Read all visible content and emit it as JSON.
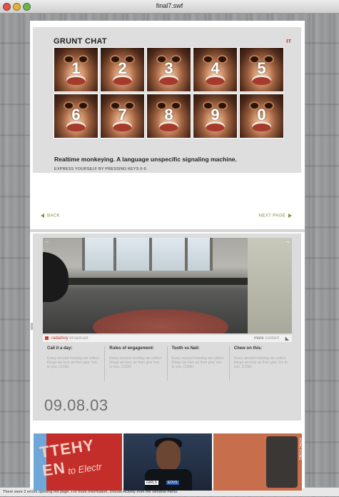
{
  "window": {
    "title": "final7.swf"
  },
  "grunt": {
    "title": "GRUNT CHAT",
    "logo": "rr",
    "faces": [
      "1",
      "2",
      "3",
      "4",
      "5",
      "6",
      "7",
      "8",
      "9",
      "0"
    ],
    "tagline": "Realtime monkeying.  A language unspecific signaling machine.",
    "instruction": "EXPRESS YOURSELF BY PRESSING KEYS 0-9"
  },
  "nav": {
    "back": "BACK",
    "next": "NEXT PAGE"
  },
  "broadcast": {
    "brand": "radarboy",
    "brand_suffix": "broadcast",
    "more": "more",
    "more_suffix": "content",
    "columns": [
      {
        "heading": "Call it a day:",
        "body": "Every second monday we collect things we love an then give 'em to you. (133k)"
      },
      {
        "heading": "Rules of engagement:",
        "body": "Every second monday we collect things we love an then give 'em to you. (133k)"
      },
      {
        "heading": "Tooth vs Nail:",
        "body": "Every second monday we collect things we love an then give 'em to you. (133k)"
      },
      {
        "heading": "Chew on this:",
        "body": "Every second monday we collect things we love an then give 'em to you. (133k)"
      }
    ],
    "date": "09.08.03"
  },
  "thumbs": {
    "t1_big": "TTEHY EN",
    "t1_small": "to Electr",
    "t2_label1": "GIRLS",
    "t2_label2": "EDVS",
    "t3_label": "HONG KONG"
  },
  "status": "There were 2 errors opening the page. For more information, choose Activity from the Window menu.",
  "colors": {
    "accent_red": "#d53a2a",
    "nav_olive": "#8a8a3a"
  }
}
